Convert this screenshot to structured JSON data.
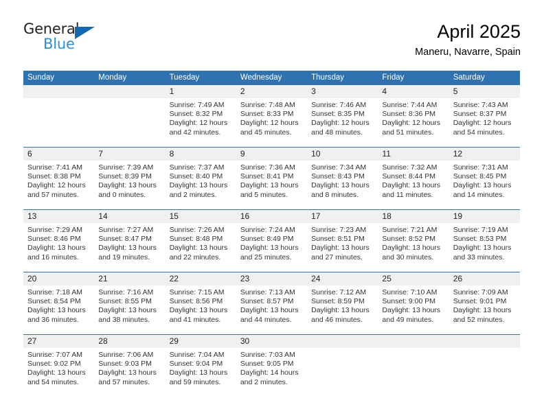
{
  "brand": {
    "name_dark": "General",
    "name_blue": "Blue",
    "logo_icon": "triangle-icon",
    "accent_color": "#1268b3",
    "blue_text_color": "#2b8fd6"
  },
  "header": {
    "title": "April 2025",
    "subtitle": "Maneru, Navarre, Spain"
  },
  "theme": {
    "header_blue": "#2f72b0",
    "day_band_gray": "#f0f0f0",
    "text_color": "#333333"
  },
  "weekdays": [
    "Sunday",
    "Monday",
    "Tuesday",
    "Wednesday",
    "Thursday",
    "Friday",
    "Saturday"
  ],
  "weeks": [
    [
      {
        "day": "",
        "lines": [
          "",
          "",
          "",
          ""
        ],
        "empty": true
      },
      {
        "day": "",
        "lines": [
          "",
          "",
          "",
          ""
        ],
        "empty": true
      },
      {
        "day": "1",
        "lines": [
          "Sunrise: 7:49 AM",
          "Sunset: 8:32 PM",
          "Daylight: 12 hours",
          "and 42 minutes."
        ]
      },
      {
        "day": "2",
        "lines": [
          "Sunrise: 7:48 AM",
          "Sunset: 8:33 PM",
          "Daylight: 12 hours",
          "and 45 minutes."
        ]
      },
      {
        "day": "3",
        "lines": [
          "Sunrise: 7:46 AM",
          "Sunset: 8:35 PM",
          "Daylight: 12 hours",
          "and 48 minutes."
        ]
      },
      {
        "day": "4",
        "lines": [
          "Sunrise: 7:44 AM",
          "Sunset: 8:36 PM",
          "Daylight: 12 hours",
          "and 51 minutes."
        ]
      },
      {
        "day": "5",
        "lines": [
          "Sunrise: 7:43 AM",
          "Sunset: 8:37 PM",
          "Daylight: 12 hours",
          "and 54 minutes."
        ]
      }
    ],
    [
      {
        "day": "6",
        "lines": [
          "Sunrise: 7:41 AM",
          "Sunset: 8:38 PM",
          "Daylight: 12 hours",
          "and 57 minutes."
        ]
      },
      {
        "day": "7",
        "lines": [
          "Sunrise: 7:39 AM",
          "Sunset: 8:39 PM",
          "Daylight: 13 hours",
          "and 0 minutes."
        ]
      },
      {
        "day": "8",
        "lines": [
          "Sunrise: 7:37 AM",
          "Sunset: 8:40 PM",
          "Daylight: 13 hours",
          "and 2 minutes."
        ]
      },
      {
        "day": "9",
        "lines": [
          "Sunrise: 7:36 AM",
          "Sunset: 8:41 PM",
          "Daylight: 13 hours",
          "and 5 minutes."
        ]
      },
      {
        "day": "10",
        "lines": [
          "Sunrise: 7:34 AM",
          "Sunset: 8:43 PM",
          "Daylight: 13 hours",
          "and 8 minutes."
        ]
      },
      {
        "day": "11",
        "lines": [
          "Sunrise: 7:32 AM",
          "Sunset: 8:44 PM",
          "Daylight: 13 hours",
          "and 11 minutes."
        ]
      },
      {
        "day": "12",
        "lines": [
          "Sunrise: 7:31 AM",
          "Sunset: 8:45 PM",
          "Daylight: 13 hours",
          "and 14 minutes."
        ]
      }
    ],
    [
      {
        "day": "13",
        "lines": [
          "Sunrise: 7:29 AM",
          "Sunset: 8:46 PM",
          "Daylight: 13 hours",
          "and 16 minutes."
        ]
      },
      {
        "day": "14",
        "lines": [
          "Sunrise: 7:27 AM",
          "Sunset: 8:47 PM",
          "Daylight: 13 hours",
          "and 19 minutes."
        ]
      },
      {
        "day": "15",
        "lines": [
          "Sunrise: 7:26 AM",
          "Sunset: 8:48 PM",
          "Daylight: 13 hours",
          "and 22 minutes."
        ]
      },
      {
        "day": "16",
        "lines": [
          "Sunrise: 7:24 AM",
          "Sunset: 8:49 PM",
          "Daylight: 13 hours",
          "and 25 minutes."
        ]
      },
      {
        "day": "17",
        "lines": [
          "Sunrise: 7:23 AM",
          "Sunset: 8:51 PM",
          "Daylight: 13 hours",
          "and 27 minutes."
        ]
      },
      {
        "day": "18",
        "lines": [
          "Sunrise: 7:21 AM",
          "Sunset: 8:52 PM",
          "Daylight: 13 hours",
          "and 30 minutes."
        ]
      },
      {
        "day": "19",
        "lines": [
          "Sunrise: 7:19 AM",
          "Sunset: 8:53 PM",
          "Daylight: 13 hours",
          "and 33 minutes."
        ]
      }
    ],
    [
      {
        "day": "20",
        "lines": [
          "Sunrise: 7:18 AM",
          "Sunset: 8:54 PM",
          "Daylight: 13 hours",
          "and 36 minutes."
        ]
      },
      {
        "day": "21",
        "lines": [
          "Sunrise: 7:16 AM",
          "Sunset: 8:55 PM",
          "Daylight: 13 hours",
          "and 38 minutes."
        ]
      },
      {
        "day": "22",
        "lines": [
          "Sunrise: 7:15 AM",
          "Sunset: 8:56 PM",
          "Daylight: 13 hours",
          "and 41 minutes."
        ]
      },
      {
        "day": "23",
        "lines": [
          "Sunrise: 7:13 AM",
          "Sunset: 8:57 PM",
          "Daylight: 13 hours",
          "and 44 minutes."
        ]
      },
      {
        "day": "24",
        "lines": [
          "Sunrise: 7:12 AM",
          "Sunset: 8:59 PM",
          "Daylight: 13 hours",
          "and 46 minutes."
        ]
      },
      {
        "day": "25",
        "lines": [
          "Sunrise: 7:10 AM",
          "Sunset: 9:00 PM",
          "Daylight: 13 hours",
          "and 49 minutes."
        ]
      },
      {
        "day": "26",
        "lines": [
          "Sunrise: 7:09 AM",
          "Sunset: 9:01 PM",
          "Daylight: 13 hours",
          "and 52 minutes."
        ]
      }
    ],
    [
      {
        "day": "27",
        "lines": [
          "Sunrise: 7:07 AM",
          "Sunset: 9:02 PM",
          "Daylight: 13 hours",
          "and 54 minutes."
        ]
      },
      {
        "day": "28",
        "lines": [
          "Sunrise: 7:06 AM",
          "Sunset: 9:03 PM",
          "Daylight: 13 hours",
          "and 57 minutes."
        ]
      },
      {
        "day": "29",
        "lines": [
          "Sunrise: 7:04 AM",
          "Sunset: 9:04 PM",
          "Daylight: 13 hours",
          "and 59 minutes."
        ]
      },
      {
        "day": "30",
        "lines": [
          "Sunrise: 7:03 AM",
          "Sunset: 9:05 PM",
          "Daylight: 14 hours",
          "and 2 minutes."
        ]
      },
      {
        "day": "",
        "lines": [
          "",
          "",
          "",
          ""
        ],
        "empty": true
      },
      {
        "day": "",
        "lines": [
          "",
          "",
          "",
          ""
        ],
        "empty": true
      },
      {
        "day": "",
        "lines": [
          "",
          "",
          "",
          ""
        ],
        "empty": true
      }
    ]
  ]
}
